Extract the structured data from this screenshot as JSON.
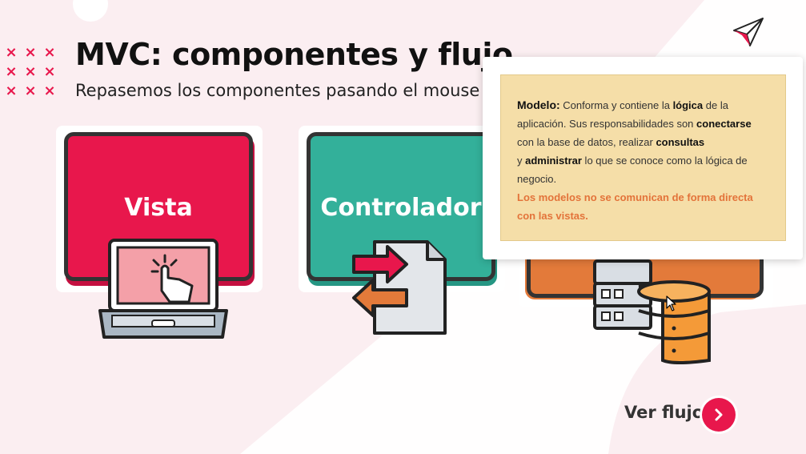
{
  "header": {
    "title": "MVC: componentes y flujo",
    "subtitle": "Repasemos los componentes pasando el mouse ..."
  },
  "decor": {
    "dots": [
      "×",
      "×",
      "×",
      "×",
      "×",
      "×",
      "×",
      "×",
      "×"
    ]
  },
  "cards": [
    {
      "label": "Vista",
      "color": "#e8174c",
      "icon": "laptop-touch-icon"
    },
    {
      "label": "Controlador",
      "color": "#33b09a",
      "icon": "file-transfer-icon"
    },
    {
      "label": "",
      "color": "#e37a3a",
      "icon": "server-database-icon"
    }
  ],
  "tooltip": {
    "heading": "Modelo:",
    "t1": " Conforma y contiene la ",
    "b1": "lógica",
    "t2": " de la aplicación. Sus responsabilidades son ",
    "b2": "conectarse",
    "t3": " con la base de datos, realizar ",
    "b3": "consultas",
    "t4": "y ",
    "b4": "administrar",
    "t5": " lo que se conoce como la lógica de negocio.",
    "warning": "Los modelos no se comunican de forma directa con las vistas."
  },
  "footer": {
    "ver_flujo": "Ver flujo",
    "next_icon": "chevron-right-icon"
  },
  "colors": {
    "accent": "#e8174c",
    "tooltip_bg": "#f5dea8",
    "warning": "#e3733a"
  }
}
